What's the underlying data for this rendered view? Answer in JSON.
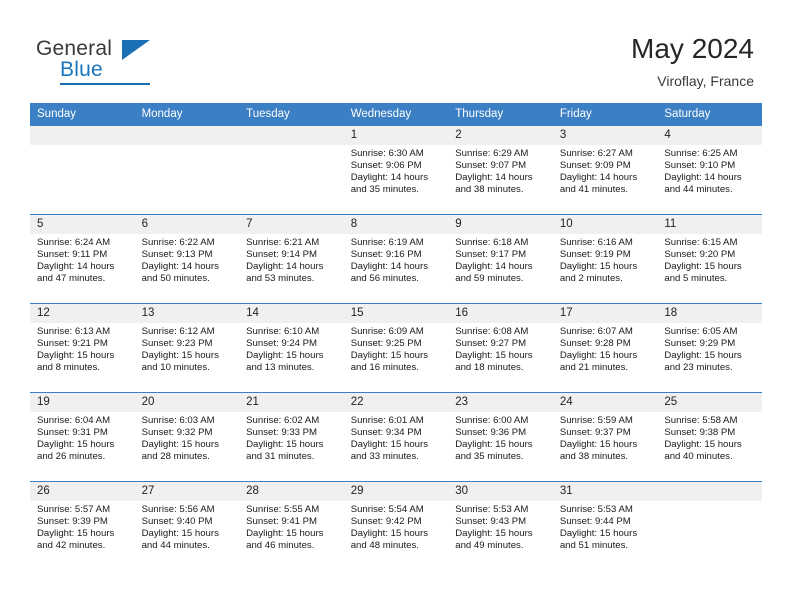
{
  "logo": {
    "word_top": "General",
    "word_bottom": "Blue",
    "triangle_color": "#1b6fb5"
  },
  "header": {
    "title": "May 2024",
    "location": "Viroflay, France"
  },
  "theme": {
    "header_blue": "#3b7fc4",
    "daynum_gray": "#f0f0f0",
    "accent": "#1b75bb"
  },
  "weekday_headers": [
    "Sunday",
    "Monday",
    "Tuesday",
    "Wednesday",
    "Thursday",
    "Friday",
    "Saturday"
  ],
  "weeks": [
    [
      {
        "day": "",
        "sunrise": "",
        "sunset": "",
        "daylight_1": "",
        "daylight_2": "",
        "empty": true
      },
      {
        "day": "",
        "sunrise": "",
        "sunset": "",
        "daylight_1": "",
        "daylight_2": "",
        "empty": true
      },
      {
        "day": "",
        "sunrise": "",
        "sunset": "",
        "daylight_1": "",
        "daylight_2": "",
        "empty": true
      },
      {
        "day": "1",
        "sunrise": "Sunrise: 6:30 AM",
        "sunset": "Sunset: 9:06 PM",
        "daylight_1": "Daylight: 14 hours",
        "daylight_2": "and 35 minutes."
      },
      {
        "day": "2",
        "sunrise": "Sunrise: 6:29 AM",
        "sunset": "Sunset: 9:07 PM",
        "daylight_1": "Daylight: 14 hours",
        "daylight_2": "and 38 minutes."
      },
      {
        "day": "3",
        "sunrise": "Sunrise: 6:27 AM",
        "sunset": "Sunset: 9:09 PM",
        "daylight_1": "Daylight: 14 hours",
        "daylight_2": "and 41 minutes."
      },
      {
        "day": "4",
        "sunrise": "Sunrise: 6:25 AM",
        "sunset": "Sunset: 9:10 PM",
        "daylight_1": "Daylight: 14 hours",
        "daylight_2": "and 44 minutes."
      }
    ],
    [
      {
        "day": "5",
        "sunrise": "Sunrise: 6:24 AM",
        "sunset": "Sunset: 9:11 PM",
        "daylight_1": "Daylight: 14 hours",
        "daylight_2": "and 47 minutes."
      },
      {
        "day": "6",
        "sunrise": "Sunrise: 6:22 AM",
        "sunset": "Sunset: 9:13 PM",
        "daylight_1": "Daylight: 14 hours",
        "daylight_2": "and 50 minutes."
      },
      {
        "day": "7",
        "sunrise": "Sunrise: 6:21 AM",
        "sunset": "Sunset: 9:14 PM",
        "daylight_1": "Daylight: 14 hours",
        "daylight_2": "and 53 minutes."
      },
      {
        "day": "8",
        "sunrise": "Sunrise: 6:19 AM",
        "sunset": "Sunset: 9:16 PM",
        "daylight_1": "Daylight: 14 hours",
        "daylight_2": "and 56 minutes."
      },
      {
        "day": "9",
        "sunrise": "Sunrise: 6:18 AM",
        "sunset": "Sunset: 9:17 PM",
        "daylight_1": "Daylight: 14 hours",
        "daylight_2": "and 59 minutes."
      },
      {
        "day": "10",
        "sunrise": "Sunrise: 6:16 AM",
        "sunset": "Sunset: 9:19 PM",
        "daylight_1": "Daylight: 15 hours",
        "daylight_2": "and 2 minutes."
      },
      {
        "day": "11",
        "sunrise": "Sunrise: 6:15 AM",
        "sunset": "Sunset: 9:20 PM",
        "daylight_1": "Daylight: 15 hours",
        "daylight_2": "and 5 minutes."
      }
    ],
    [
      {
        "day": "12",
        "sunrise": "Sunrise: 6:13 AM",
        "sunset": "Sunset: 9:21 PM",
        "daylight_1": "Daylight: 15 hours",
        "daylight_2": "and 8 minutes."
      },
      {
        "day": "13",
        "sunrise": "Sunrise: 6:12 AM",
        "sunset": "Sunset: 9:23 PM",
        "daylight_1": "Daylight: 15 hours",
        "daylight_2": "and 10 minutes."
      },
      {
        "day": "14",
        "sunrise": "Sunrise: 6:10 AM",
        "sunset": "Sunset: 9:24 PM",
        "daylight_1": "Daylight: 15 hours",
        "daylight_2": "and 13 minutes."
      },
      {
        "day": "15",
        "sunrise": "Sunrise: 6:09 AM",
        "sunset": "Sunset: 9:25 PM",
        "daylight_1": "Daylight: 15 hours",
        "daylight_2": "and 16 minutes."
      },
      {
        "day": "16",
        "sunrise": "Sunrise: 6:08 AM",
        "sunset": "Sunset: 9:27 PM",
        "daylight_1": "Daylight: 15 hours",
        "daylight_2": "and 18 minutes."
      },
      {
        "day": "17",
        "sunrise": "Sunrise: 6:07 AM",
        "sunset": "Sunset: 9:28 PM",
        "daylight_1": "Daylight: 15 hours",
        "daylight_2": "and 21 minutes."
      },
      {
        "day": "18",
        "sunrise": "Sunrise: 6:05 AM",
        "sunset": "Sunset: 9:29 PM",
        "daylight_1": "Daylight: 15 hours",
        "daylight_2": "and 23 minutes."
      }
    ],
    [
      {
        "day": "19",
        "sunrise": "Sunrise: 6:04 AM",
        "sunset": "Sunset: 9:31 PM",
        "daylight_1": "Daylight: 15 hours",
        "daylight_2": "and 26 minutes."
      },
      {
        "day": "20",
        "sunrise": "Sunrise: 6:03 AM",
        "sunset": "Sunset: 9:32 PM",
        "daylight_1": "Daylight: 15 hours",
        "daylight_2": "and 28 minutes."
      },
      {
        "day": "21",
        "sunrise": "Sunrise: 6:02 AM",
        "sunset": "Sunset: 9:33 PM",
        "daylight_1": "Daylight: 15 hours",
        "daylight_2": "and 31 minutes."
      },
      {
        "day": "22",
        "sunrise": "Sunrise: 6:01 AM",
        "sunset": "Sunset: 9:34 PM",
        "daylight_1": "Daylight: 15 hours",
        "daylight_2": "and 33 minutes."
      },
      {
        "day": "23",
        "sunrise": "Sunrise: 6:00 AM",
        "sunset": "Sunset: 9:36 PM",
        "daylight_1": "Daylight: 15 hours",
        "daylight_2": "and 35 minutes."
      },
      {
        "day": "24",
        "sunrise": "Sunrise: 5:59 AM",
        "sunset": "Sunset: 9:37 PM",
        "daylight_1": "Daylight: 15 hours",
        "daylight_2": "and 38 minutes."
      },
      {
        "day": "25",
        "sunrise": "Sunrise: 5:58 AM",
        "sunset": "Sunset: 9:38 PM",
        "daylight_1": "Daylight: 15 hours",
        "daylight_2": "and 40 minutes."
      }
    ],
    [
      {
        "day": "26",
        "sunrise": "Sunrise: 5:57 AM",
        "sunset": "Sunset: 9:39 PM",
        "daylight_1": "Daylight: 15 hours",
        "daylight_2": "and 42 minutes."
      },
      {
        "day": "27",
        "sunrise": "Sunrise: 5:56 AM",
        "sunset": "Sunset: 9:40 PM",
        "daylight_1": "Daylight: 15 hours",
        "daylight_2": "and 44 minutes."
      },
      {
        "day": "28",
        "sunrise": "Sunrise: 5:55 AM",
        "sunset": "Sunset: 9:41 PM",
        "daylight_1": "Daylight: 15 hours",
        "daylight_2": "and 46 minutes."
      },
      {
        "day": "29",
        "sunrise": "Sunrise: 5:54 AM",
        "sunset": "Sunset: 9:42 PM",
        "daylight_1": "Daylight: 15 hours",
        "daylight_2": "and 48 minutes."
      },
      {
        "day": "30",
        "sunrise": "Sunrise: 5:53 AM",
        "sunset": "Sunset: 9:43 PM",
        "daylight_1": "Daylight: 15 hours",
        "daylight_2": "and 49 minutes."
      },
      {
        "day": "31",
        "sunrise": "Sunrise: 5:53 AM",
        "sunset": "Sunset: 9:44 PM",
        "daylight_1": "Daylight: 15 hours",
        "daylight_2": "and 51 minutes."
      },
      {
        "day": "",
        "sunrise": "",
        "sunset": "",
        "daylight_1": "",
        "daylight_2": "",
        "empty": true
      }
    ]
  ]
}
